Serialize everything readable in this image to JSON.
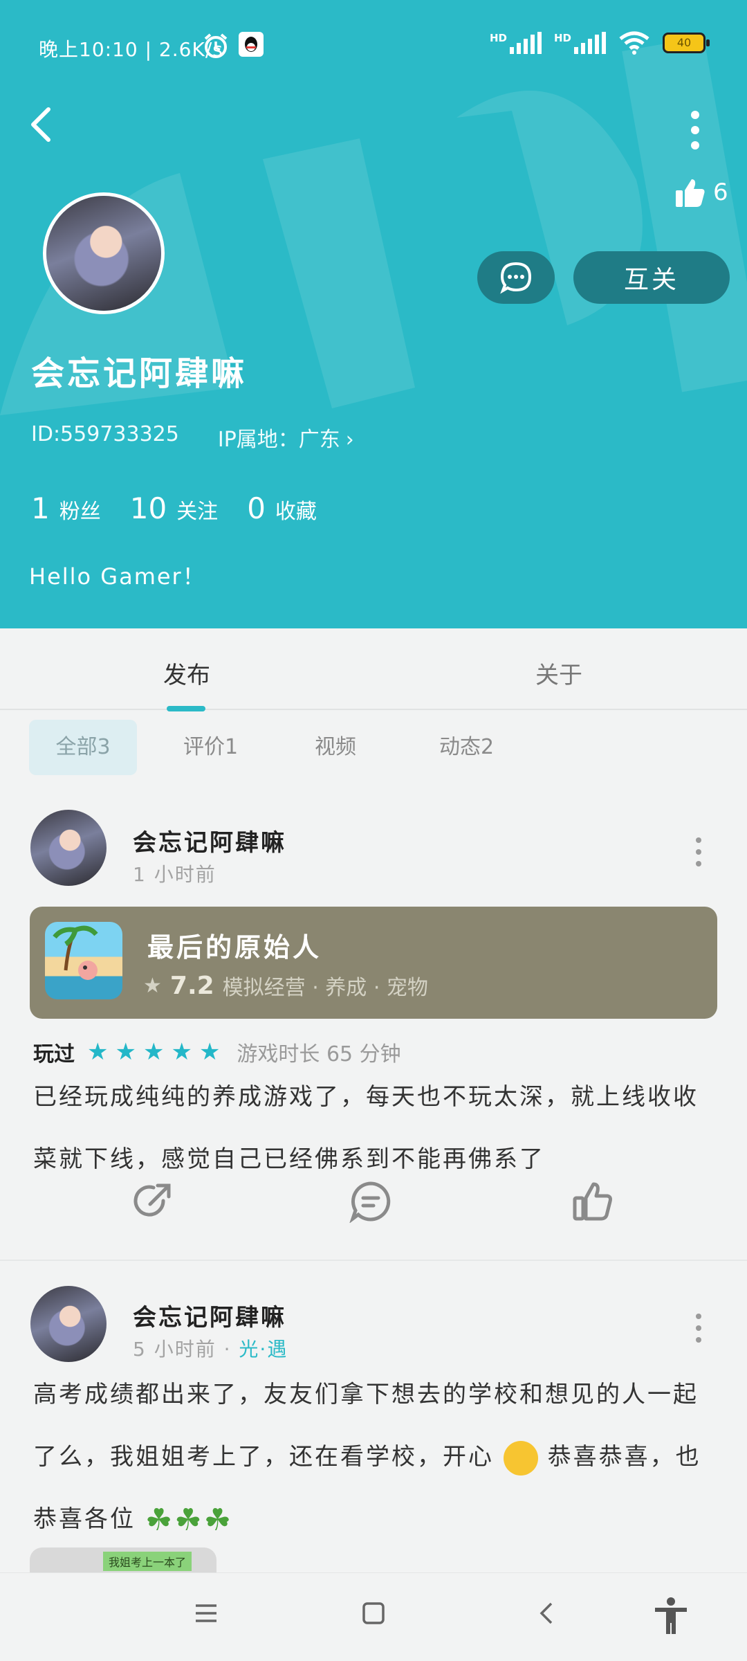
{
  "status_bar": {
    "time": "晚上10:10 | 2.6K/s",
    "network": "HD",
    "battery": "40"
  },
  "profile": {
    "nickname": "会忘记阿肆嘛",
    "id": "ID:559733325",
    "ip_location": "IP属地：广东",
    "likes": "6",
    "follow_button": "互关",
    "stats": [
      {
        "num": "1",
        "label": "粉丝"
      },
      {
        "num": "10",
        "label": "关注"
      },
      {
        "num": "0",
        "label": "收藏"
      }
    ],
    "bio": "Hello Gamer！"
  },
  "tabs": {
    "publish": "发布",
    "about": "关于"
  },
  "filters": [
    "全部3",
    "评价1",
    "视频",
    "动态2"
  ],
  "posts": [
    {
      "author": "会忘记阿肆嘛",
      "time": "1 小时前",
      "game": {
        "title": "最后的原始人",
        "score": "7.2",
        "tags": "模拟经营 · 养成 · 宠物"
      },
      "rating_label": "玩过",
      "stars": 5,
      "playtime": "游戏时长 65 分钟",
      "body": "已经玩成纯纯的养成游戏了，每天也不玩太深，就上线收收菜就下线，感觉自己已经佛系到不能再佛系了"
    },
    {
      "author": "会忘记阿肆嘛",
      "time": "5 小时前 · ",
      "tag": "光·遇",
      "body_a": "高考成绩都出来了，友友们拿下想去的学校和想见的人一起了么，我姐姐考上了，还在看学校，开心",
      "body_b": "恭喜恭喜，也恭喜各位",
      "image_caption": "我姐考上一本了"
    }
  ],
  "icons": {
    "back": "chevron-left-icon",
    "more": "more-vertical-icon",
    "like": "thumbs-up-icon",
    "chat": "chat-bubble-icon",
    "share": "share-icon",
    "comment": "comment-icon"
  },
  "colors": {
    "accent": "#2bbac7",
    "button_dark": "#1f7c86",
    "game_card": "#8a8670"
  }
}
